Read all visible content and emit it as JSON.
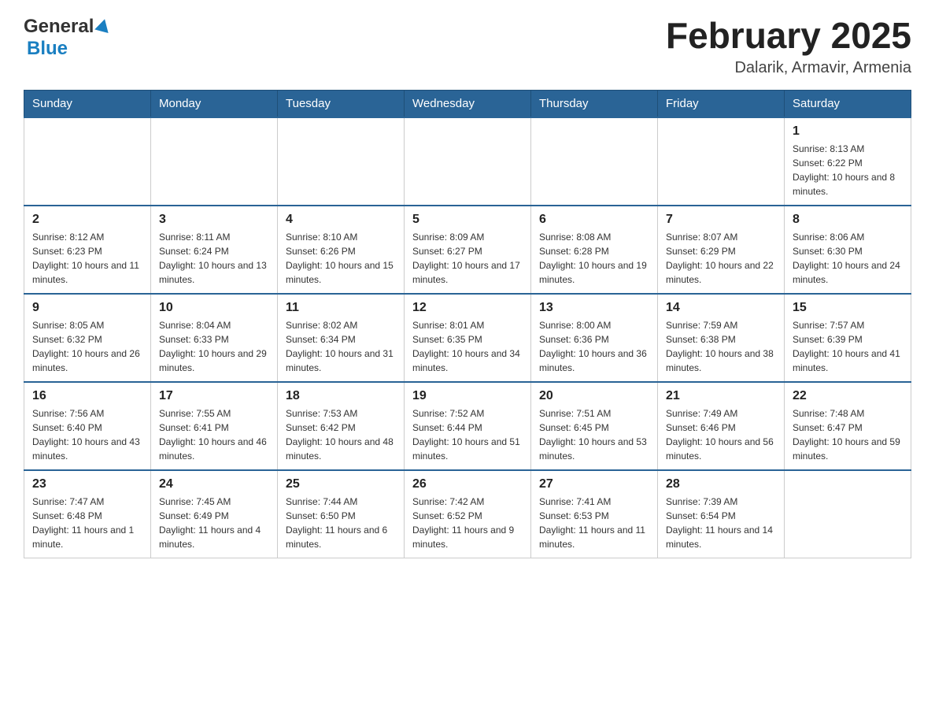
{
  "header": {
    "logo_general": "General",
    "logo_blue": "Blue",
    "month_title": "February 2025",
    "location": "Dalarik, Armavir, Armenia"
  },
  "weekdays": [
    "Sunday",
    "Monday",
    "Tuesday",
    "Wednesday",
    "Thursday",
    "Friday",
    "Saturday"
  ],
  "weeks": [
    [
      {
        "day": "",
        "info": ""
      },
      {
        "day": "",
        "info": ""
      },
      {
        "day": "",
        "info": ""
      },
      {
        "day": "",
        "info": ""
      },
      {
        "day": "",
        "info": ""
      },
      {
        "day": "",
        "info": ""
      },
      {
        "day": "1",
        "info": "Sunrise: 8:13 AM\nSunset: 6:22 PM\nDaylight: 10 hours and 8 minutes."
      }
    ],
    [
      {
        "day": "2",
        "info": "Sunrise: 8:12 AM\nSunset: 6:23 PM\nDaylight: 10 hours and 11 minutes."
      },
      {
        "day": "3",
        "info": "Sunrise: 8:11 AM\nSunset: 6:24 PM\nDaylight: 10 hours and 13 minutes."
      },
      {
        "day": "4",
        "info": "Sunrise: 8:10 AM\nSunset: 6:26 PM\nDaylight: 10 hours and 15 minutes."
      },
      {
        "day": "5",
        "info": "Sunrise: 8:09 AM\nSunset: 6:27 PM\nDaylight: 10 hours and 17 minutes."
      },
      {
        "day": "6",
        "info": "Sunrise: 8:08 AM\nSunset: 6:28 PM\nDaylight: 10 hours and 19 minutes."
      },
      {
        "day": "7",
        "info": "Sunrise: 8:07 AM\nSunset: 6:29 PM\nDaylight: 10 hours and 22 minutes."
      },
      {
        "day": "8",
        "info": "Sunrise: 8:06 AM\nSunset: 6:30 PM\nDaylight: 10 hours and 24 minutes."
      }
    ],
    [
      {
        "day": "9",
        "info": "Sunrise: 8:05 AM\nSunset: 6:32 PM\nDaylight: 10 hours and 26 minutes."
      },
      {
        "day": "10",
        "info": "Sunrise: 8:04 AM\nSunset: 6:33 PM\nDaylight: 10 hours and 29 minutes."
      },
      {
        "day": "11",
        "info": "Sunrise: 8:02 AM\nSunset: 6:34 PM\nDaylight: 10 hours and 31 minutes."
      },
      {
        "day": "12",
        "info": "Sunrise: 8:01 AM\nSunset: 6:35 PM\nDaylight: 10 hours and 34 minutes."
      },
      {
        "day": "13",
        "info": "Sunrise: 8:00 AM\nSunset: 6:36 PM\nDaylight: 10 hours and 36 minutes."
      },
      {
        "day": "14",
        "info": "Sunrise: 7:59 AM\nSunset: 6:38 PM\nDaylight: 10 hours and 38 minutes."
      },
      {
        "day": "15",
        "info": "Sunrise: 7:57 AM\nSunset: 6:39 PM\nDaylight: 10 hours and 41 minutes."
      }
    ],
    [
      {
        "day": "16",
        "info": "Sunrise: 7:56 AM\nSunset: 6:40 PM\nDaylight: 10 hours and 43 minutes."
      },
      {
        "day": "17",
        "info": "Sunrise: 7:55 AM\nSunset: 6:41 PM\nDaylight: 10 hours and 46 minutes."
      },
      {
        "day": "18",
        "info": "Sunrise: 7:53 AM\nSunset: 6:42 PM\nDaylight: 10 hours and 48 minutes."
      },
      {
        "day": "19",
        "info": "Sunrise: 7:52 AM\nSunset: 6:44 PM\nDaylight: 10 hours and 51 minutes."
      },
      {
        "day": "20",
        "info": "Sunrise: 7:51 AM\nSunset: 6:45 PM\nDaylight: 10 hours and 53 minutes."
      },
      {
        "day": "21",
        "info": "Sunrise: 7:49 AM\nSunset: 6:46 PM\nDaylight: 10 hours and 56 minutes."
      },
      {
        "day": "22",
        "info": "Sunrise: 7:48 AM\nSunset: 6:47 PM\nDaylight: 10 hours and 59 minutes."
      }
    ],
    [
      {
        "day": "23",
        "info": "Sunrise: 7:47 AM\nSunset: 6:48 PM\nDaylight: 11 hours and 1 minute."
      },
      {
        "day": "24",
        "info": "Sunrise: 7:45 AM\nSunset: 6:49 PM\nDaylight: 11 hours and 4 minutes."
      },
      {
        "day": "25",
        "info": "Sunrise: 7:44 AM\nSunset: 6:50 PM\nDaylight: 11 hours and 6 minutes."
      },
      {
        "day": "26",
        "info": "Sunrise: 7:42 AM\nSunset: 6:52 PM\nDaylight: 11 hours and 9 minutes."
      },
      {
        "day": "27",
        "info": "Sunrise: 7:41 AM\nSunset: 6:53 PM\nDaylight: 11 hours and 11 minutes."
      },
      {
        "day": "28",
        "info": "Sunrise: 7:39 AM\nSunset: 6:54 PM\nDaylight: 11 hours and 14 minutes."
      },
      {
        "day": "",
        "info": ""
      }
    ]
  ]
}
